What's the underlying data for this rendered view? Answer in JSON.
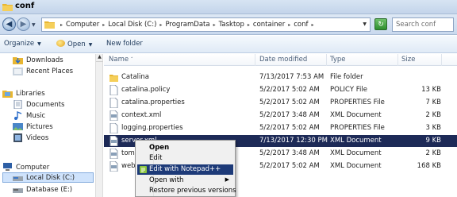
{
  "window": {
    "title": "conf"
  },
  "address": {
    "crumbs": [
      "Computer",
      "Local Disk (C:)",
      "ProgramData",
      "Tasktop",
      "container",
      "conf"
    ],
    "search_placeholder": "Search conf"
  },
  "toolbar": {
    "organize": "Organize",
    "open": "Open",
    "new_folder": "New folder"
  },
  "nav": {
    "items": [
      {
        "label": "Downloads",
        "icon": "downloads-icon"
      },
      {
        "label": "Recent Places",
        "icon": "recent-places-icon"
      },
      {
        "label": "Libraries",
        "icon": "libraries-icon"
      },
      {
        "label": "Documents",
        "icon": "documents-icon"
      },
      {
        "label": "Music",
        "icon": "music-icon"
      },
      {
        "label": "Pictures",
        "icon": "pictures-icon"
      },
      {
        "label": "Videos",
        "icon": "videos-icon"
      },
      {
        "label": "Computer",
        "icon": "computer-icon"
      },
      {
        "label": "Local Disk (C:)",
        "icon": "drive-icon"
      },
      {
        "label": "Database (E:)",
        "icon": "drive-icon"
      }
    ]
  },
  "columns": {
    "name": "Name",
    "date": "Date modified",
    "type": "Type",
    "size": "Size"
  },
  "files": [
    {
      "name": "Catalina",
      "date": "7/13/2017 7:53 AM",
      "type": "File folder",
      "size": "",
      "icon": "folder-icon"
    },
    {
      "name": "catalina.policy",
      "date": "5/2/2017 5:02 AM",
      "type": "POLICY File",
      "size": "13 KB",
      "icon": "file-icon"
    },
    {
      "name": "catalina.properties",
      "date": "5/2/2017 5:02 AM",
      "type": "PROPERTIES File",
      "size": "7 KB",
      "icon": "file-icon"
    },
    {
      "name": "context.xml",
      "date": "5/2/2017 3:48 AM",
      "type": "XML Document",
      "size": "2 KB",
      "icon": "xml-file-icon"
    },
    {
      "name": "logging.properties",
      "date": "5/2/2017 5:02 AM",
      "type": "PROPERTIES File",
      "size": "3 KB",
      "icon": "file-icon"
    },
    {
      "name": "server.xml",
      "date": "7/13/2017 12:30 PM",
      "type": "XML Document",
      "size": "9 KB",
      "icon": "xml-file-icon"
    },
    {
      "name": "tomca",
      "date": "5/2/2017 3:48 AM",
      "type": "XML Document",
      "size": "2 KB",
      "icon": "xml-file-icon"
    },
    {
      "name": "web.x",
      "date": "5/2/2017 5:02 AM",
      "type": "XML Document",
      "size": "168 KB",
      "icon": "xml-file-icon"
    }
  ],
  "context_menu": {
    "items": [
      {
        "label": "Open"
      },
      {
        "label": "Edit"
      },
      {
        "label": "Edit with Notepad++"
      },
      {
        "label": "Open with"
      },
      {
        "label": "Restore previous versions"
      }
    ]
  }
}
